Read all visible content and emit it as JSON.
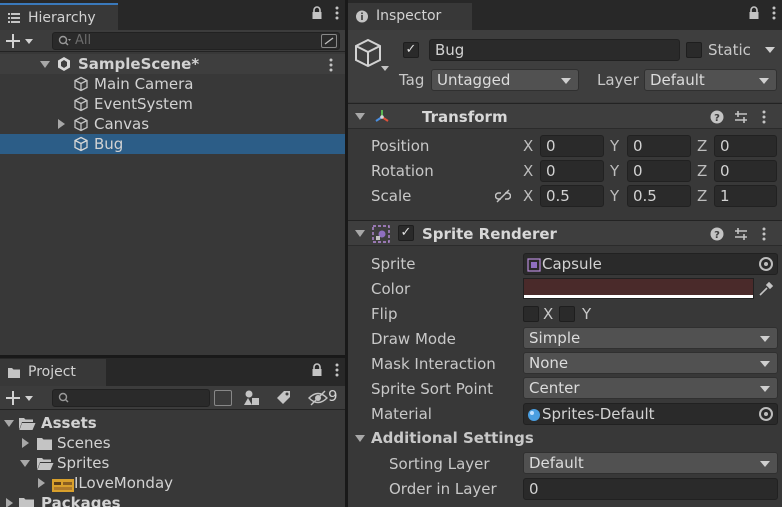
{
  "hierarchy": {
    "tab_label": "Hierarchy",
    "search_placeholder": "All",
    "scene_name": "SampleScene*",
    "items": [
      {
        "label": "Main Camera"
      },
      {
        "label": "EventSystem"
      },
      {
        "label": "Canvas"
      },
      {
        "label": "Bug"
      }
    ]
  },
  "project": {
    "tab_label": "Project",
    "hidden_count": "9",
    "items": [
      {
        "label": "Assets"
      },
      {
        "label": "Scenes"
      },
      {
        "label": "Sprites"
      },
      {
        "label": "ILoveMonday"
      },
      {
        "label": "Packages"
      }
    ]
  },
  "inspector": {
    "tab_label": "Inspector",
    "object_name": "Bug",
    "static_label": "Static",
    "tag_label": "Tag",
    "tag_value": "Untagged",
    "layer_label": "Layer",
    "layer_value": "Default",
    "transform": {
      "title": "Transform",
      "position_label": "Position",
      "rotation_label": "Rotation",
      "scale_label": "Scale",
      "x": "X",
      "y": "Y",
      "z": "Z",
      "position": {
        "x": "0",
        "y": "0",
        "z": "0"
      },
      "rotation": {
        "x": "0",
        "y": "0",
        "z": "0"
      },
      "scale": {
        "x": "0.5",
        "y": "0.5",
        "z": "1"
      }
    },
    "sprite_renderer": {
      "title": "Sprite Renderer",
      "sprite_label": "Sprite",
      "sprite_value": "Capsule",
      "color_label": "Color",
      "color_value": "#4a2a2a",
      "flip_label": "Flip",
      "flip_x": "X",
      "flip_y": "Y",
      "draw_mode_label": "Draw Mode",
      "draw_mode_value": "Simple",
      "mask_label": "Mask Interaction",
      "mask_value": "None",
      "sort_point_label": "Sprite Sort Point",
      "sort_point_value": "Center",
      "material_label": "Material",
      "material_value": "Sprites-Default",
      "additional_label": "Additional Settings",
      "sorting_layer_label": "Sorting Layer",
      "sorting_layer_value": "Default",
      "order_label": "Order in Layer",
      "order_value": "0"
    }
  },
  "colors": {
    "selection": "#2c5d87",
    "accent": "#3a79bb"
  }
}
